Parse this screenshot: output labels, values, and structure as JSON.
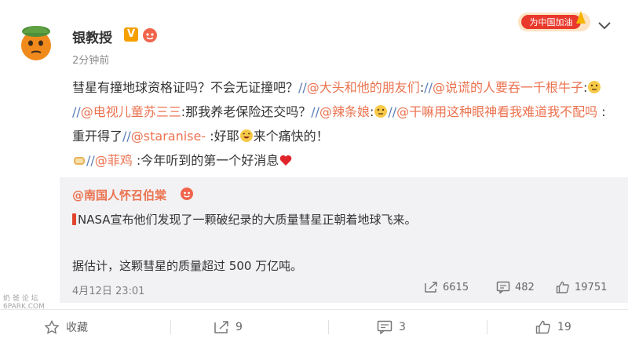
{
  "post": {
    "username": "银教授",
    "verified_badge": "V",
    "time": "2分钟前",
    "banner_text": "为中国加油",
    "content": {
      "p1": "彗星有撞地球资格证吗？不会无证撞吧？",
      "sep1": "//",
      "m1": "@大头和他的朋友们",
      "c1": ":",
      "sep2": "//",
      "m2": "@说谎的人要吞一千根牛子",
      "c2": ":",
      "sep3": "//",
      "m3": "@电视儿童苏三三",
      "t3": ":那我养老保险还交吗？",
      "sep4": "//",
      "m4": "@辣条娘",
      "c4": ":",
      "sep5": "//",
      "m5": "@干嘛用这种眼神看我难道我不配吗",
      "t5": " :重开得了",
      "sep6": "//",
      "m6": "@staranise-",
      "t6": " :好耶",
      "t6b": "来个痛快的！",
      "sep7": "//",
      "m7": "@菲鸡",
      "t7": " :今年听到的第一个好消息"
    }
  },
  "repost": {
    "username": "@南国人怀召伯棠",
    "line1": "NASA宣布他们发现了一颗破纪录的大质量彗星正朝着地球飞来。",
    "line2": "据估计，这颗彗星的质量超过 500 万亿吨。",
    "date": "4月12日 23:01",
    "shares": "6615",
    "comments": "482",
    "likes": "19751"
  },
  "actions": {
    "favorite": "收藏",
    "repost": "9",
    "comment": "3",
    "like": "19"
  },
  "watermark": {
    "line1": "奶 爸 论 坛",
    "line2": "6PARK.COM"
  },
  "colors": {
    "mention": "#eb7350",
    "separator": "#5b7fb5",
    "repost_bg": "#f2f2f5",
    "badge": "#f5a000"
  },
  "icons": [
    "avatar",
    "verified-icon",
    "fan-badge-icon",
    "chevron-down-icon",
    "thinking-emoji-icon",
    "laugh-emoji-icon",
    "bread-emoji-icon",
    "heart-icon",
    "share-icon",
    "comment-icon",
    "like-icon",
    "favorite-icon"
  ]
}
